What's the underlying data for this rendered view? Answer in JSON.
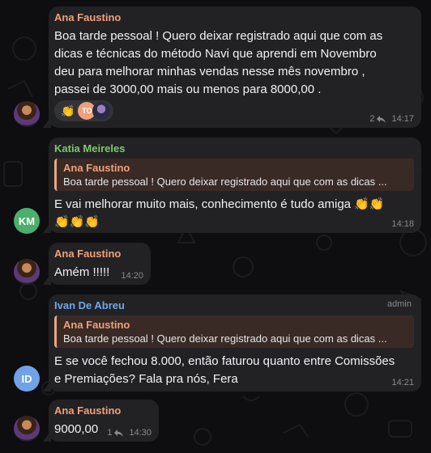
{
  "colors": {
    "ana": "#f0a07a",
    "katia": "#7ec86a",
    "ivan": "#6fa8e8",
    "avatar_km": "#4caf6e",
    "avatar_id": "#6fa3e6",
    "avatar_to": "#f0a07a"
  },
  "messages": [
    {
      "sender": "Ana Faustino",
      "lines": [
        "Boa tarde pessoal ! Quero deixar registrado aqui que com as",
        "dicas e técnicas do método Navi que aprendi em Novembro",
        "deu para melhorar minhas vendas nesse mês novembro ,",
        "passei de 3000,00 mais ou menos para 8000,00 ."
      ],
      "reactions": {
        "emoji": "👏",
        "initials": "TO"
      },
      "replies": "2",
      "time": "14:17"
    },
    {
      "sender": "Katia Meireles",
      "avatar_initials": "KM",
      "quote": {
        "name": "Ana Faustino",
        "text": "Boa tarde pessoal ! Quero deixar registrado aqui que com as dicas ..."
      },
      "lines": [
        "E vai melhorar muito mais, conhecimento é tudo amiga 👏👏",
        "👏👏👏"
      ],
      "time": "14:18"
    },
    {
      "sender": "Ana Faustino",
      "lines": [
        "Amém !!!!!"
      ],
      "time": "14:20"
    },
    {
      "sender": "Ivan De Abreu",
      "badge": "admin",
      "avatar_initials": "ID",
      "quote": {
        "name": "Ana Faustino",
        "text": "Boa tarde pessoal ! Quero deixar registrado aqui que com as dicas ..."
      },
      "lines": [
        "E se você fechou 8.000, então faturou quanto entre Comissões",
        "e Premiações? Fala pra nós, Fera"
      ],
      "time": "14:21"
    },
    {
      "sender": "Ana Faustino",
      "lines": [
        "9000,00"
      ],
      "replies": "1",
      "time": "14:30"
    }
  ]
}
